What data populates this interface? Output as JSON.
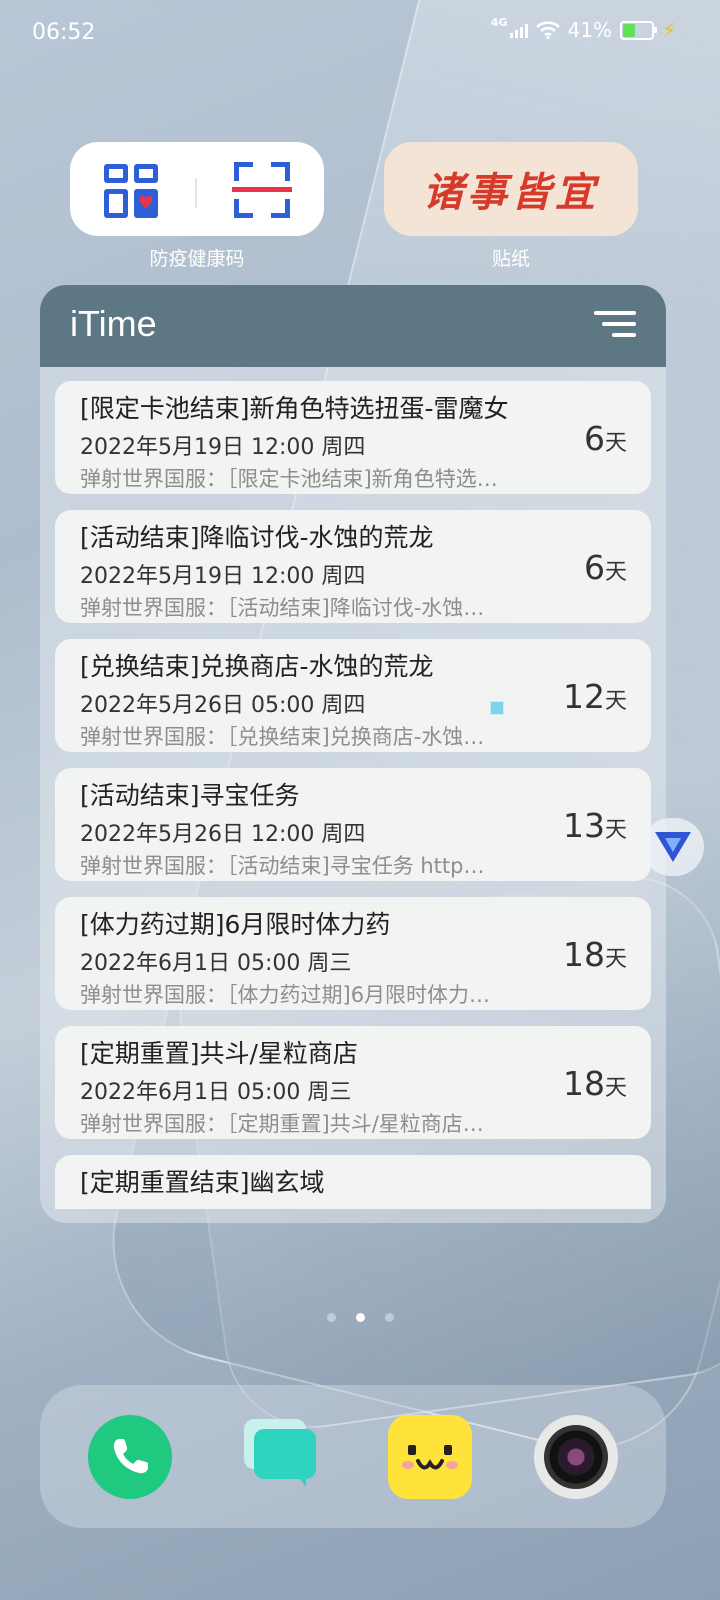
{
  "status_bar": {
    "time": "06:52",
    "network": "4G",
    "battery": "41%",
    "battery_level": 0.41
  },
  "widgets": {
    "health_code": {
      "label": "防疫健康码"
    },
    "sticker": {
      "text": "诸事皆宜",
      "label": "贴纸"
    }
  },
  "itime": {
    "title": "iTime",
    "events": [
      {
        "title": "[限定卡池结束]新角色特选扭蛋-雷魔女",
        "date": "2022年5月19日 12:00 周四",
        "note": "弹射世界国服：［限定卡池结束]新角色特选…",
        "days": "6",
        "unit": "天"
      },
      {
        "title": "[活动结束]降临讨伐-水蚀的荒龙",
        "date": "2022年5月19日 12:00 周四",
        "note": "弹射世界国服：［活动结束]降临讨伐-水蚀…",
        "days": "6",
        "unit": "天"
      },
      {
        "title": "[兑换结束]兑换商店-水蚀的荒龙",
        "date": "2022年5月26日 05:00 周四",
        "note": "弹射世界国服：［兑换结束]兑换商店-水蚀…",
        "days": "12",
        "unit": "天"
      },
      {
        "title": "[活动结束]寻宝任务",
        "date": "2022年5月26日 12:00 周四",
        "note": "弹射世界国服：［活动结束]寻宝任务 http…",
        "days": "13",
        "unit": "天"
      },
      {
        "title": "[体力药过期]6月限时体力药",
        "date": "2022年6月1日 05:00 周三",
        "note": "弹射世界国服：［体力药过期]6月限时体力…",
        "days": "18",
        "unit": "天"
      },
      {
        "title": "[定期重置]共斗/星粒商店",
        "date": "2022年6月1日 05:00 周三",
        "note": "弹射世界国服：［定期重置]共斗/星粒商店…",
        "days": "18",
        "unit": "天"
      },
      {
        "title": "[定期重置结束]幽玄域",
        "date": "",
        "note": "",
        "days": "",
        "unit": ""
      }
    ]
  },
  "home": {
    "page_count": 3,
    "current_page": 2
  },
  "dock": {
    "apps": [
      {
        "icon": "phone-icon",
        "color": "#1fca80"
      },
      {
        "icon": "messages-icon",
        "color": "#2ed4c0"
      },
      {
        "icon": "smiley-icon",
        "color": "#ffe33a"
      },
      {
        "icon": "camera-icon",
        "color": "#e8e8e8"
      }
    ]
  }
}
